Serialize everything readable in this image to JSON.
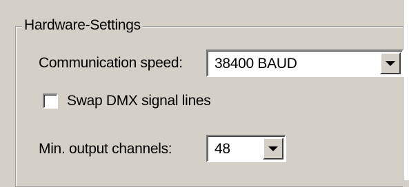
{
  "group": {
    "title": "Hardware-Settings"
  },
  "communication_speed": {
    "label": "Communication speed:",
    "value": "38400 BAUD"
  },
  "swap_dmx": {
    "label": "Swap DMX signal lines",
    "checked": false
  },
  "min_output": {
    "label": "Min. output channels:",
    "value": "48"
  },
  "icons": {
    "dropdown": "chevron-down-icon"
  }
}
